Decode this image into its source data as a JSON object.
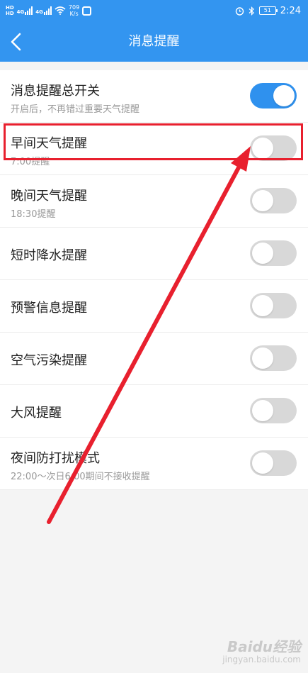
{
  "status_bar": {
    "hd_top": "HD",
    "hd_bottom": "HD",
    "signal_1": "4G",
    "signal_2": "4G",
    "speed_value": "709",
    "speed_unit": "K/s",
    "battery": "51",
    "time": "2:24"
  },
  "header": {
    "title": "消息提醒",
    "back_icon": "chevron-left-icon"
  },
  "settings": [
    {
      "title": "消息提醒总开关",
      "subtitle": "开启后，不再错过重要天气提醒",
      "enabled": true
    },
    {
      "title": "早间天气提醒",
      "subtitle": "7:00提醒",
      "enabled": false
    },
    {
      "title": "晚间天气提醒",
      "subtitle": "18:30提醒",
      "enabled": false
    },
    {
      "title": "短时降水提醒",
      "subtitle": "",
      "enabled": false
    },
    {
      "title": "预警信息提醒",
      "subtitle": "",
      "enabled": false
    },
    {
      "title": "空气污染提醒",
      "subtitle": "",
      "enabled": false
    },
    {
      "title": "大风提醒",
      "subtitle": "",
      "enabled": false
    },
    {
      "title": "夜间防打扰模式",
      "subtitle": "22:00～次日6:00期间不接收提醒",
      "enabled": false
    }
  ],
  "watermark": {
    "brand": "Baidu经验",
    "url": "jingyan.baidu.com"
  },
  "colors": {
    "primary": "#3395f0",
    "toggle_on": "#2f91ee",
    "toggle_off": "#d8d8d8",
    "annotation": "#e8202e"
  }
}
